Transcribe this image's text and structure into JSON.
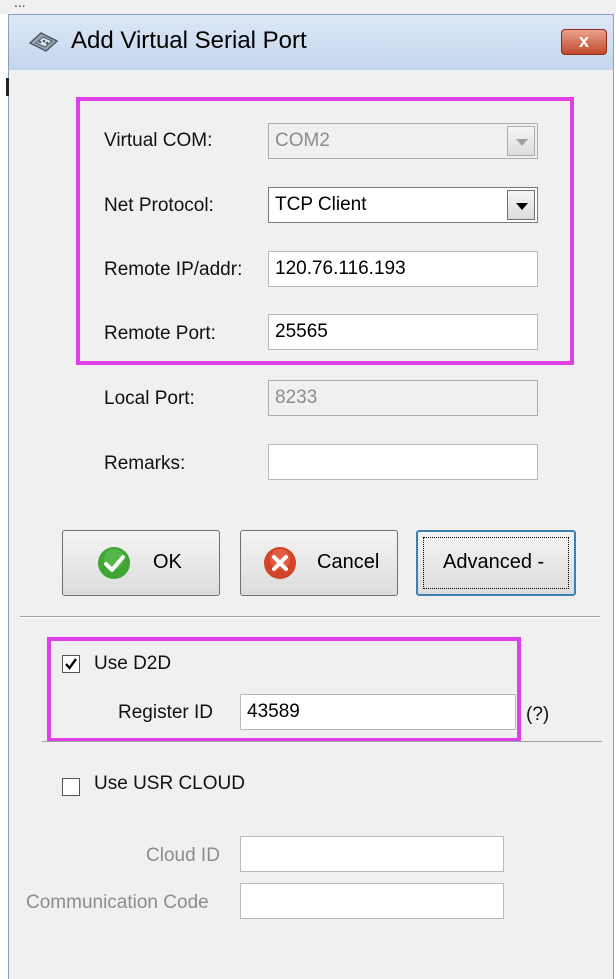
{
  "background_title": "...",
  "window": {
    "title": "Add Virtual Serial Port",
    "close_glyph": "x"
  },
  "form": {
    "virtual_com": {
      "label": "Virtual COM:",
      "value": "COM2"
    },
    "net_protocol": {
      "label": "Net Protocol:",
      "value": "TCP Client"
    },
    "remote_ip": {
      "label": "Remote IP/addr:",
      "value": "120.76.116.193"
    },
    "remote_port": {
      "label": "Remote Port:",
      "value": "25565"
    },
    "local_port": {
      "label": "Local Port:",
      "value": "8233"
    },
    "remarks": {
      "label": "Remarks:",
      "value": ""
    }
  },
  "buttons": {
    "ok": "OK",
    "cancel": "Cancel",
    "advanced": "Advanced -"
  },
  "d2d": {
    "checkbox_label": "Use D2D",
    "checked": true,
    "register_id_label": "Register ID",
    "register_id_value": "43589",
    "help": "(?)"
  },
  "cloud": {
    "checkbox_label": "Use USR CLOUD",
    "checked": false,
    "cloud_id_label": "Cloud ID",
    "cloud_id_value": "",
    "comm_code_label": "Communication Code",
    "comm_code_value": ""
  },
  "colors": {
    "highlight": "#e040e8",
    "ok_icon": "#3fa535",
    "cancel_icon": "#d2452b",
    "dialog_bg": "#f0f0f0"
  },
  "icons": [
    "serial-port-icon",
    "close-icon",
    "dropdown-arrow-icon",
    "ok-check-icon",
    "cancel-x-icon",
    "checkbox-check-icon"
  ]
}
